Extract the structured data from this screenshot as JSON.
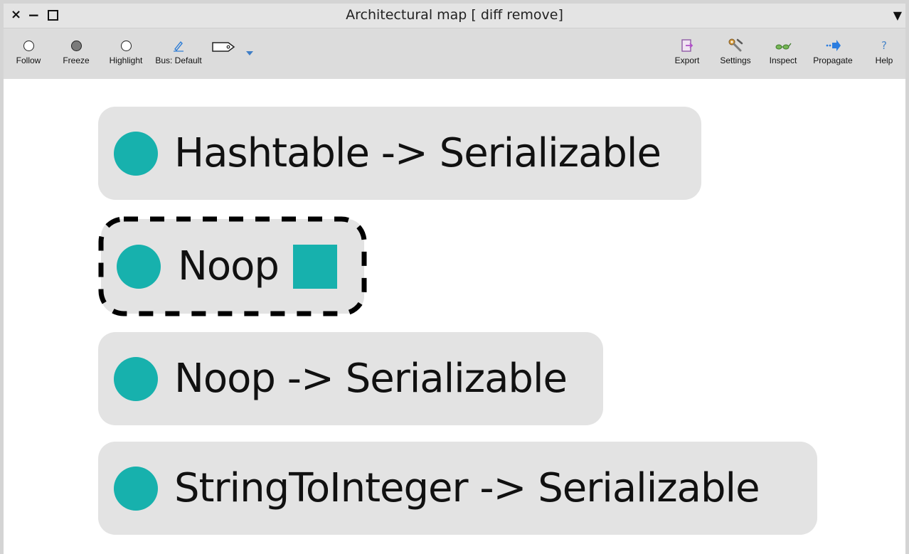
{
  "window": {
    "title": "Architectural map [ diff remove]",
    "controls": {
      "close": "×",
      "minimize": "−",
      "maximize": "□",
      "menu": "▼"
    }
  },
  "toolbar": {
    "left": [
      {
        "id": "follow",
        "label": "Follow",
        "icon": "radio-empty-icon"
      },
      {
        "id": "freeze",
        "label": "Freeze",
        "icon": "radio-filled-icon"
      },
      {
        "id": "highlight",
        "label": "Highlight",
        "icon": "radio-empty-icon"
      },
      {
        "id": "bus",
        "label": "Bus: Default",
        "icon": "pencil-icon"
      },
      {
        "id": "tag",
        "label": "",
        "icon": "tag-icon"
      }
    ],
    "right": [
      {
        "id": "export",
        "label": "Export",
        "icon": "export-icon"
      },
      {
        "id": "settings",
        "label": "Settings",
        "icon": "wrench-icon"
      },
      {
        "id": "inspect",
        "label": "Inspect",
        "icon": "glasses-icon"
      },
      {
        "id": "propagate",
        "label": "Propagate",
        "icon": "arrow-right-icon"
      },
      {
        "id": "help",
        "label": "Help",
        "icon": "help-icon"
      }
    ]
  },
  "colors": {
    "node_background": "#e3e3e3",
    "node_dot": "#17b1ad",
    "selection_border": "#000000"
  },
  "nodes": [
    {
      "label": "Hashtable -> Serializable",
      "selected": false,
      "has_square": false
    },
    {
      "label": "Noop",
      "selected": true,
      "has_square": true
    },
    {
      "label": "Noop -> Serializable",
      "selected": false,
      "has_square": false
    },
    {
      "label": "StringToInteger -> Serializable",
      "selected": false,
      "has_square": false
    }
  ]
}
